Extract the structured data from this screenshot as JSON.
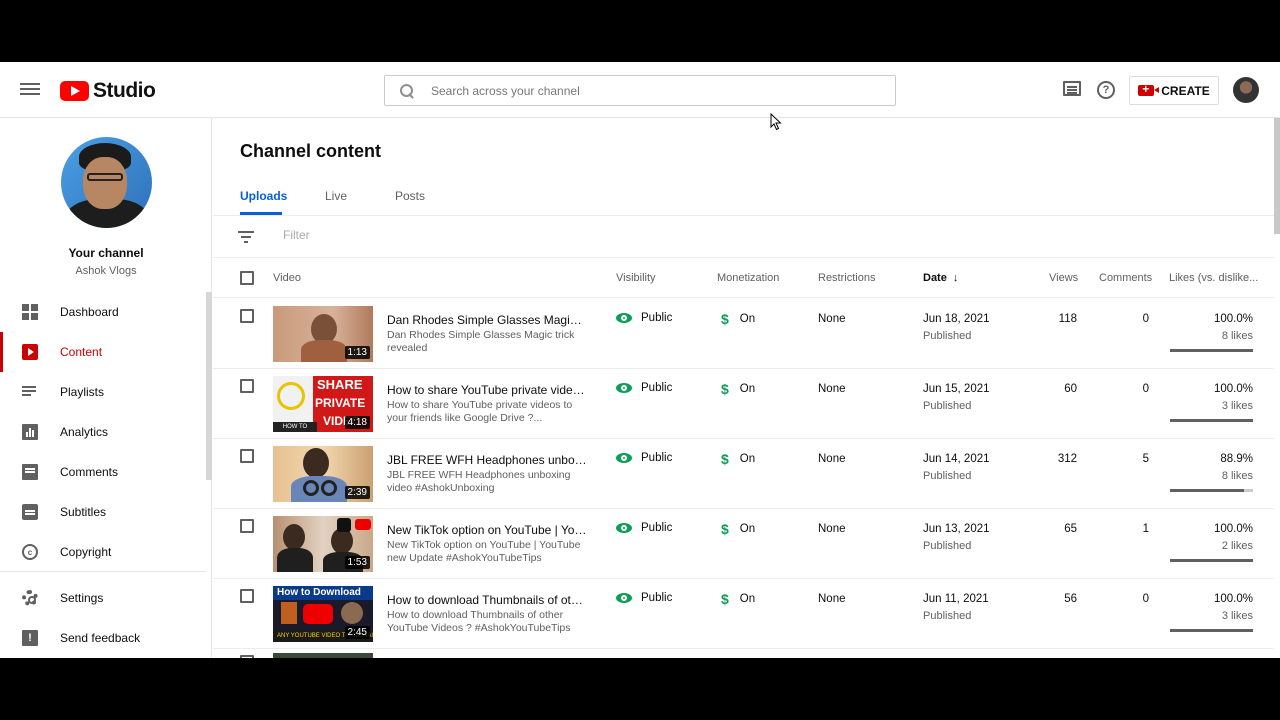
{
  "header": {
    "logo_text": "Studio",
    "search_placeholder": "Search across your channel",
    "create_label": "CREATE"
  },
  "sidebar": {
    "channel_title": "Your channel",
    "channel_name": "Ashok Vlogs",
    "items": [
      {
        "label": "Dashboard",
        "icon": "dashboard-icon"
      },
      {
        "label": "Content",
        "icon": "content-icon",
        "active": true
      },
      {
        "label": "Playlists",
        "icon": "playlists-icon"
      },
      {
        "label": "Analytics",
        "icon": "analytics-icon"
      },
      {
        "label": "Comments",
        "icon": "comments-icon"
      },
      {
        "label": "Subtitles",
        "icon": "subtitles-icon"
      },
      {
        "label": "Copyright",
        "icon": "copyright-icon"
      },
      {
        "label": "Settings",
        "icon": "settings-icon"
      },
      {
        "label": "Send feedback",
        "icon": "feedback-icon"
      }
    ]
  },
  "main": {
    "title": "Channel content",
    "tabs": [
      "Uploads",
      "Live",
      "Posts"
    ],
    "filter_placeholder": "Filter",
    "columns": {
      "video": "Video",
      "visibility": "Visibility",
      "monetization": "Monetization",
      "restrictions": "Restrictions",
      "date": "Date",
      "date_arrow": "↓",
      "views": "Views",
      "comments": "Comments",
      "likes": "Likes (vs. dislike..."
    },
    "rows": [
      {
        "title": "Dan Rhodes Simple Glasses Magic tric...",
        "desc": "Dan Rhodes Simple Glasses Magic trick revealed",
        "duration": "1:13",
        "visibility": "Public",
        "monetization": "On",
        "restrictions": "None",
        "date": "Jun 18, 2021",
        "status": "Published",
        "views": "118",
        "comments": "0",
        "likes_pct": "100.0%",
        "likes_count": "8 likes",
        "likes_ratio": 1.0
      },
      {
        "title": "How to share YouTube private videos t...",
        "desc": "How to share YouTube private videos to your friends like Google Drive ?...",
        "duration": "4:18",
        "visibility": "Public",
        "monetization": "On",
        "restrictions": "None",
        "date": "Jun 15, 2021",
        "status": "Published",
        "views": "60",
        "comments": "0",
        "likes_pct": "100.0%",
        "likes_count": "3 likes",
        "likes_ratio": 1.0
      },
      {
        "title": "JBL FREE WFH Headphones unboxing ...",
        "desc": "JBL FREE WFH Headphones unboxing video #AshokUnboxing",
        "duration": "2:39",
        "visibility": "Public",
        "monetization": "On",
        "restrictions": "None",
        "date": "Jun 14, 2021",
        "status": "Published",
        "views": "312",
        "comments": "5",
        "likes_pct": "88.9%",
        "likes_count": "8 likes",
        "likes_ratio": 0.889
      },
      {
        "title": "New TikTok option on YouTube | YouTu...",
        "desc": "New TikTok option on YouTube | YouTube new Update #AshokYouTubeTips",
        "duration": "1:53",
        "visibility": "Public",
        "monetization": "On",
        "restrictions": "None",
        "date": "Jun 13, 2021",
        "status": "Published",
        "views": "65",
        "comments": "1",
        "likes_pct": "100.0%",
        "likes_count": "2 likes",
        "likes_ratio": 1.0
      },
      {
        "title": "How to download Thumbnails of other ...",
        "desc": "How to download Thumbnails of other YouTube Videos ? #AshokYouTubeTips",
        "duration": "2:45",
        "visibility": "Public",
        "monetization": "On",
        "restrictions": "None",
        "date": "Jun 11, 2021",
        "status": "Published",
        "views": "56",
        "comments": "0",
        "likes_pct": "100.0%",
        "likes_count": "3 likes",
        "likes_ratio": 1.0
      }
    ],
    "thumb_texts": {
      "share_line1": "SHARE",
      "share_line2": "PRIVATE",
      "share_line3": "VIDEO",
      "share_small": "HOW TO SHARE",
      "dl_title": "How to Download",
      "dl_sub": "ANY YOUTUBE VIDEO THUMBNAIL"
    }
  },
  "colors": {
    "accent_blue": "#065fd4",
    "brand_red": "#cc0000",
    "public_green": "#0f9d58"
  }
}
